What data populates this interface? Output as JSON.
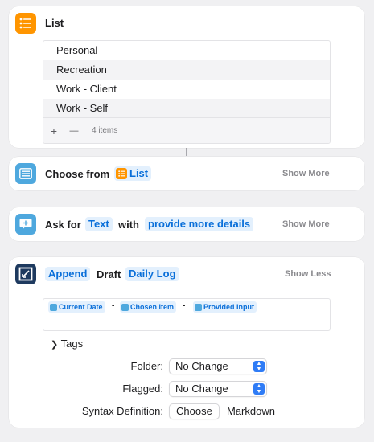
{
  "list_action": {
    "title": "List",
    "items": [
      "Personal",
      "Recreation",
      "Work - Client",
      "Work - Self"
    ],
    "add_label": "+",
    "remove_label": "—",
    "count_label": "4 items",
    "icon": "list-icon",
    "icon_color": "#ff9500"
  },
  "choose_action": {
    "title": "Choose from",
    "variable": "List",
    "show_more": "Show More",
    "icon": "choose-menu-icon",
    "icon_color": "#4ea8de"
  },
  "ask_action": {
    "title": "Ask for",
    "type_token": "Text",
    "with_label": "with",
    "prompt_token": "provide more details",
    "show_more": "Show More",
    "icon": "ask-bubble-icon",
    "icon_color": "#4ea8de"
  },
  "draft_action": {
    "mode_token": "Append",
    "draft_label": "Draft",
    "draft_token": "Daily Log",
    "show_less": "Show Less",
    "icon": "drafts-app-icon",
    "icon_color": "#1e3a5f",
    "text_tokens": [
      "Current Date",
      "Chosen Item",
      "Provided Input"
    ],
    "separator": "-",
    "tags_label": "Tags",
    "folder_label": "Folder:",
    "folder_value": "No Change",
    "flagged_label": "Flagged:",
    "flagged_value": "No Change",
    "syntax_label": "Syntax Definition:",
    "choose_button": "Choose",
    "syntax_value": "Markdown"
  }
}
